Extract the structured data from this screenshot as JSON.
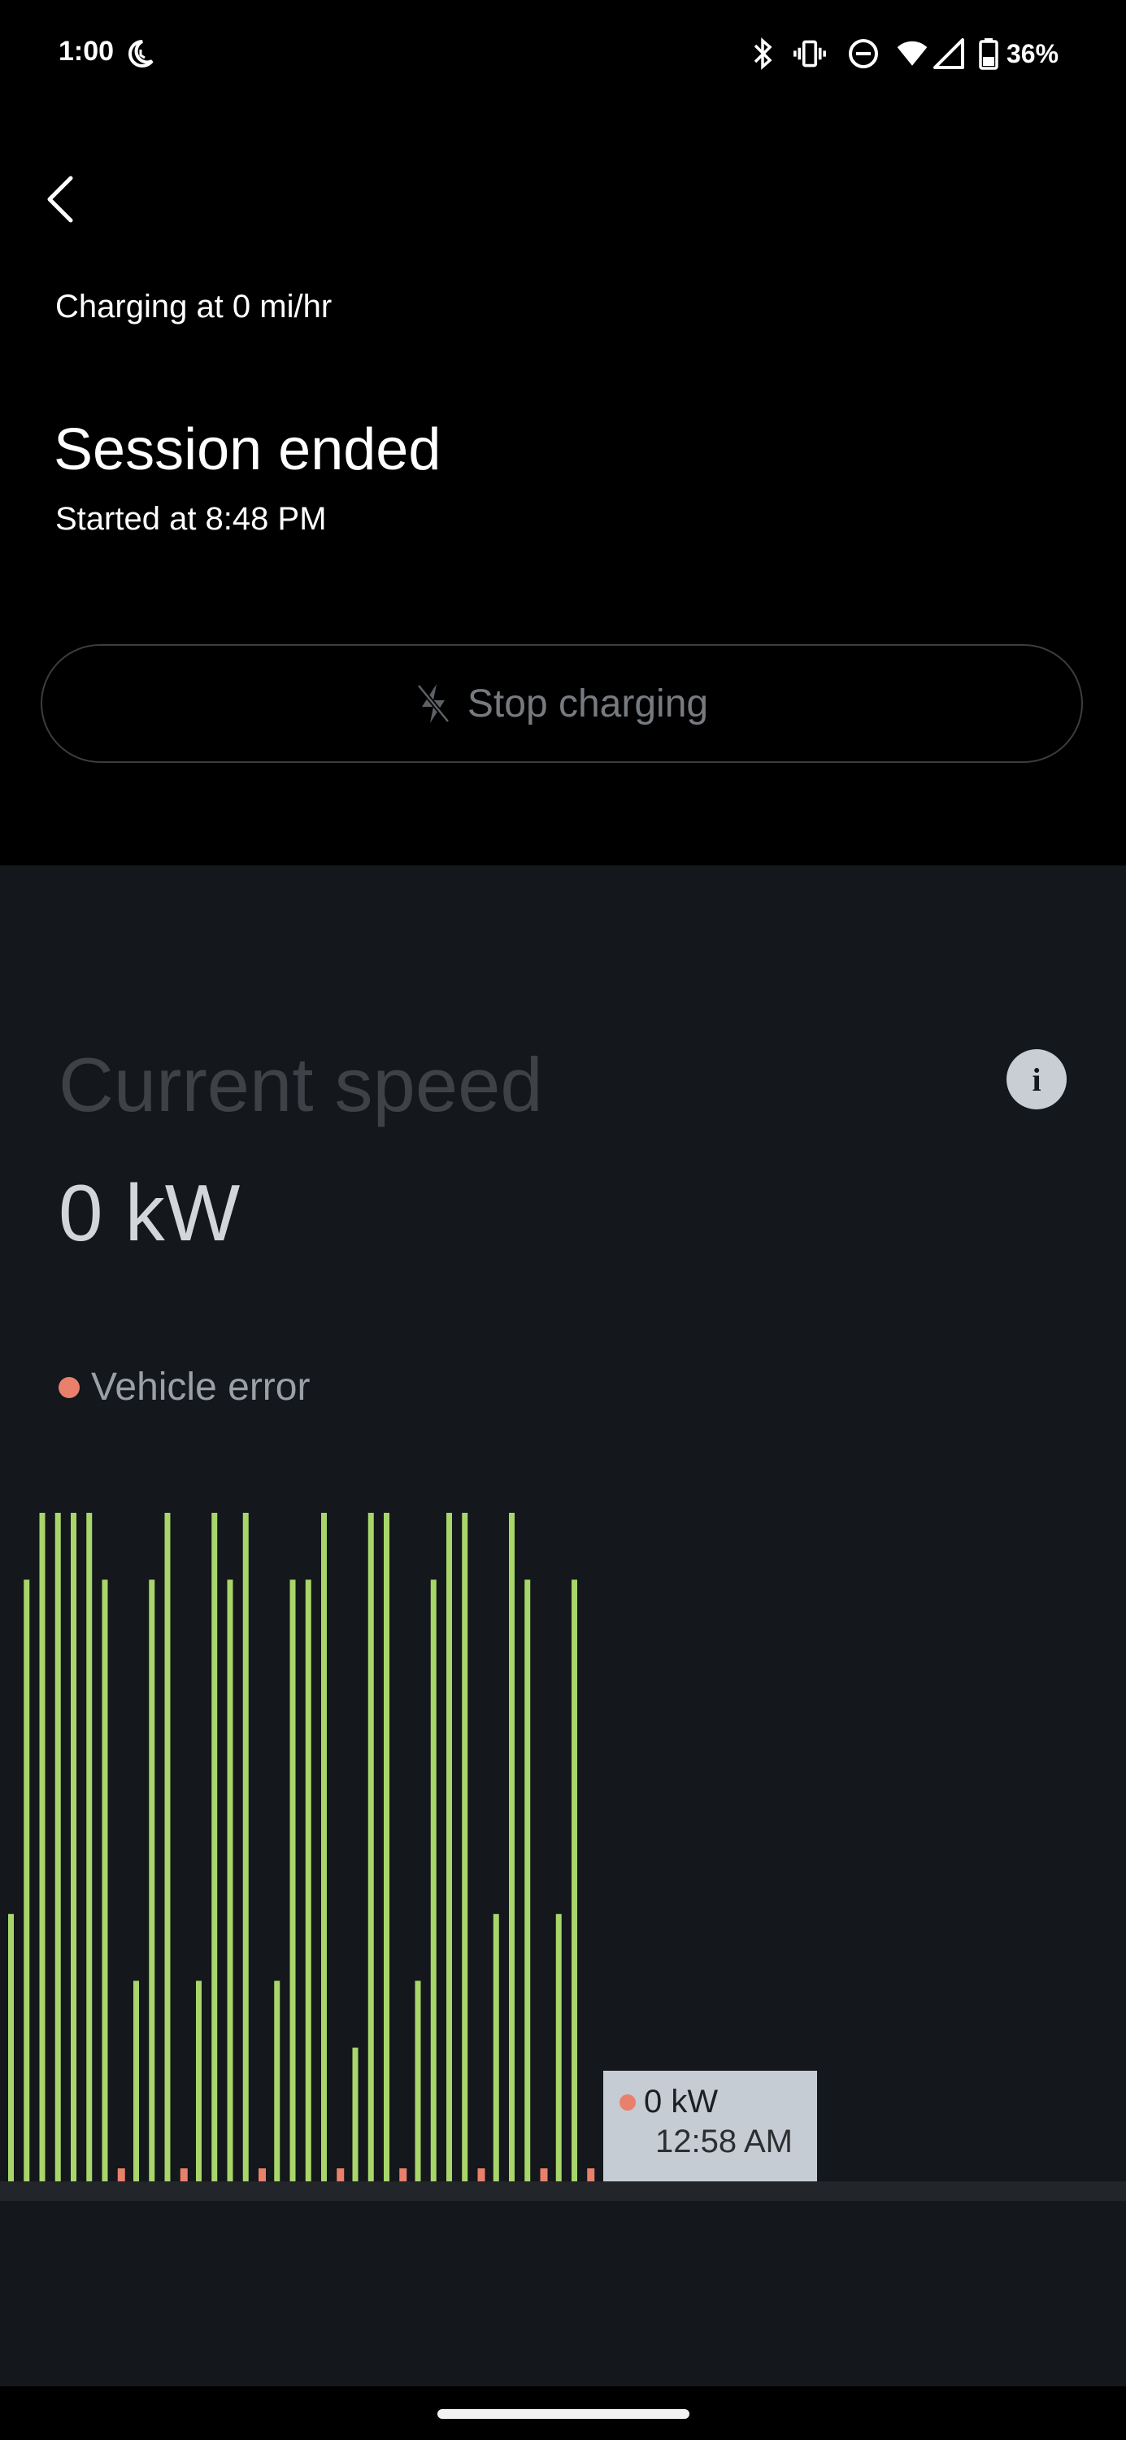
{
  "status_bar": {
    "time": "1:00",
    "battery_percent": "36%",
    "icons": [
      "moon-clock-icon",
      "bluetooth-icon",
      "vibrate-icon",
      "do-not-disturb-icon",
      "wifi-icon",
      "signal-icon",
      "battery-icon"
    ]
  },
  "header": {
    "charging_rate": "Charging at 0 mi/hr",
    "session_title": "Session ended",
    "session_subtitle": "Started at 8:48 PM",
    "stop_button_label": "Stop charging"
  },
  "speed": {
    "title": "Current speed",
    "value": "0 kW",
    "info_label": "i"
  },
  "legend": {
    "label": "Vehicle error",
    "color": "#e8806c"
  },
  "tooltip": {
    "value": "0 kW",
    "time": "12:58 AM"
  },
  "colors": {
    "bar": "#a8d66b",
    "error": "#e8806c",
    "panel": "#14171b"
  },
  "chart_data": {
    "type": "bar",
    "categories": [],
    "series": [
      {
        "values": [
          4,
          9,
          10,
          10,
          10,
          10,
          9,
          0,
          3,
          9,
          10,
          0,
          3,
          10,
          9,
          10,
          0,
          3,
          9,
          9,
          10,
          0,
          2,
          10,
          10,
          0,
          3,
          9,
          10,
          10,
          0,
          4,
          10,
          9,
          0,
          4,
          9,
          0
        ]
      }
    ],
    "errors": [
      false,
      false,
      false,
      false,
      false,
      false,
      false,
      true,
      false,
      false,
      false,
      true,
      false,
      false,
      false,
      false,
      true,
      false,
      false,
      false,
      false,
      true,
      false,
      false,
      false,
      true,
      false,
      false,
      false,
      false,
      true,
      false,
      false,
      false,
      true,
      false,
      false,
      true
    ],
    "ylim": [
      0,
      10
    ]
  }
}
